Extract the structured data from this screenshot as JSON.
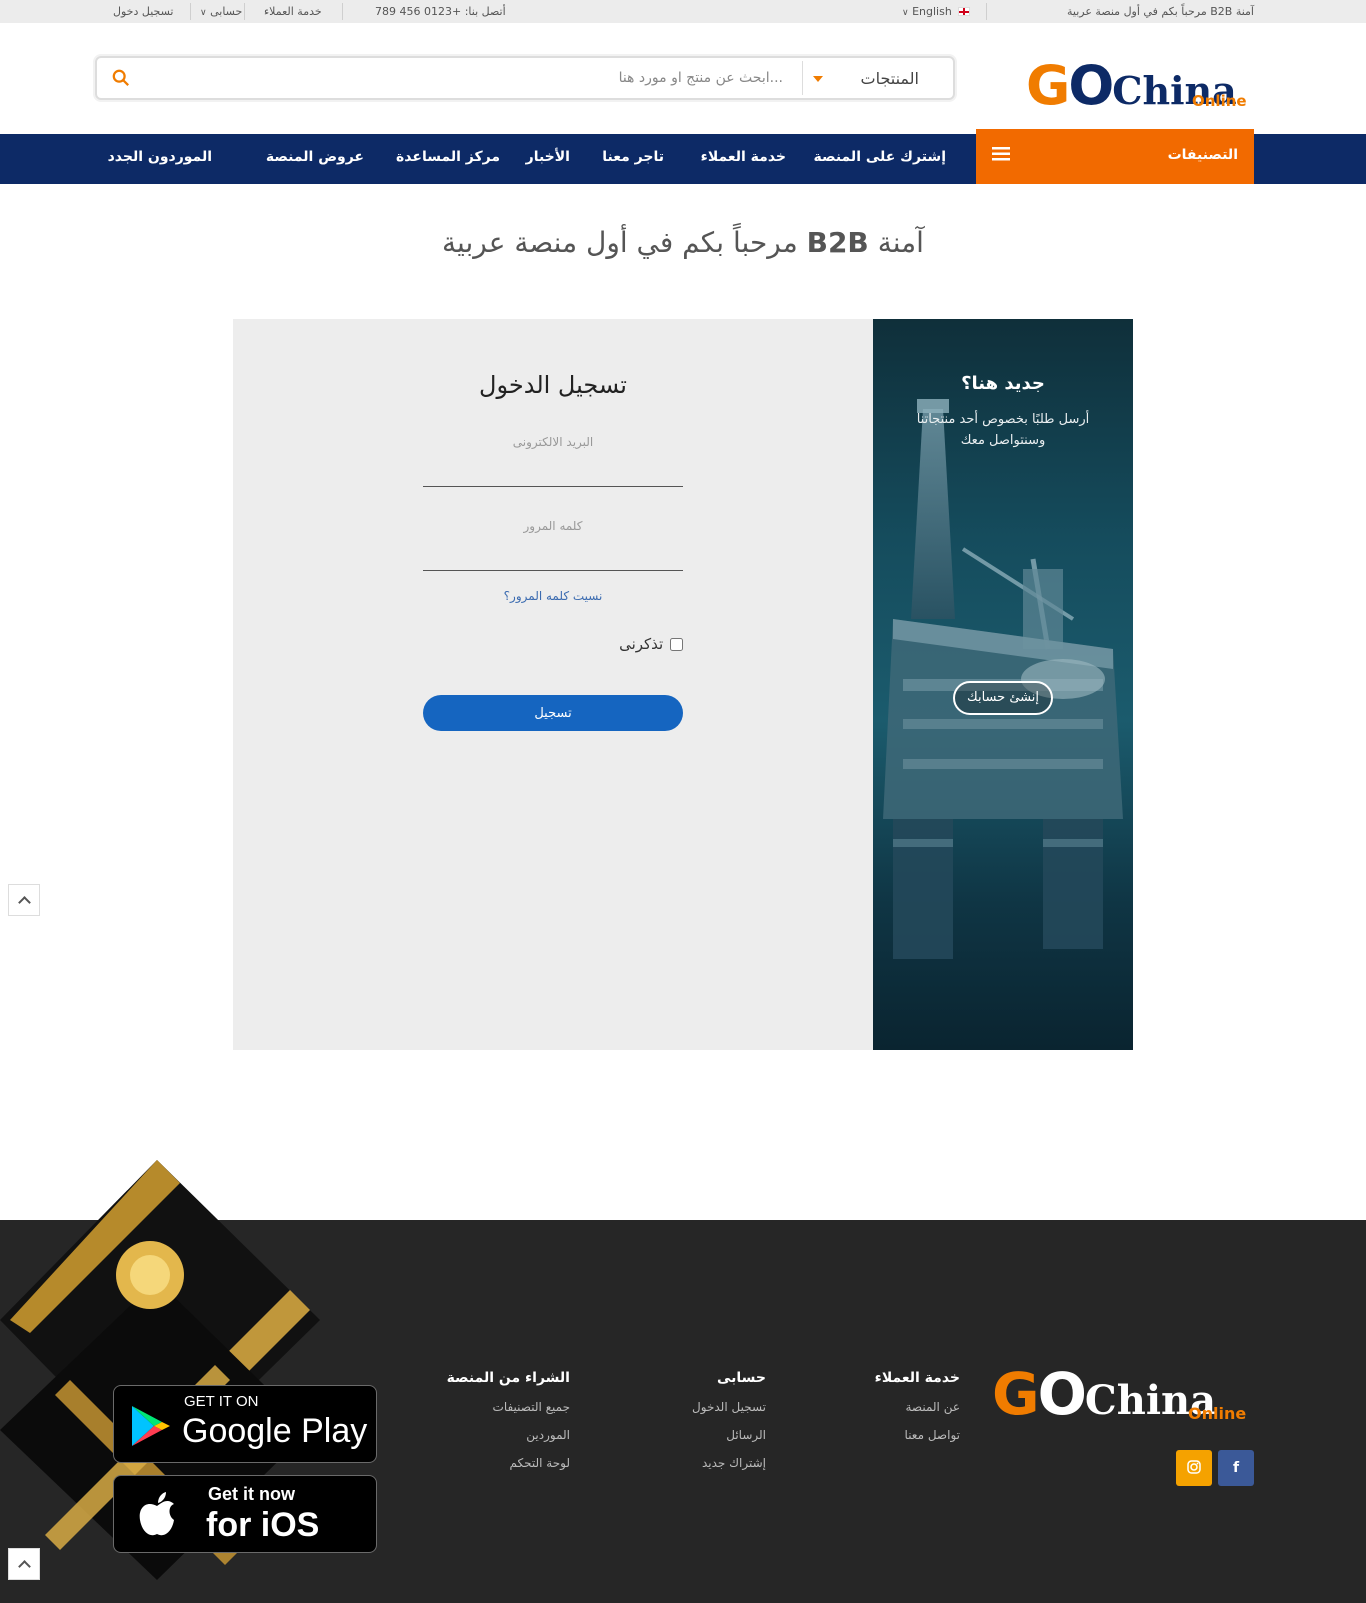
{
  "topbar": {
    "welcome": "مرحباً بكم في أول منصة عربية B2B آمنة",
    "language": "English",
    "contact": "أتصل بنا: +0123 456 789",
    "customer_service": "خدمة العملاء",
    "account": "حسابى",
    "login": "تسجيل دخول"
  },
  "header": {
    "logo_go": "GO",
    "logo_china": "China",
    "logo_online": "Online",
    "search_placeholder": "ابحث عن منتج او مورد هنا...",
    "search_category": "المنتجات"
  },
  "nav": {
    "categories": "التصنيفات",
    "items": [
      "إشترك على المنصة",
      "خدمة العملاء",
      "تاجر معنا",
      "الأخبار",
      "مركز المساعدة",
      "عروض المنصة",
      "الموردون الجدد"
    ]
  },
  "page": {
    "heading_pre": "مرحباً بكم في أول منصة عربية",
    "heading_bold": "B2B",
    "heading_post": "آمنة"
  },
  "login": {
    "title": "تسجيل الدخول",
    "email_label": "البريد الالكترونى",
    "password_label": "كلمه المرور",
    "forgot": "نسيت كلمه المرور؟",
    "remember": "تذكرنى",
    "submit": "تسجيل"
  },
  "promo": {
    "title": "جديد هنا؟",
    "text": "أرسل طلبًا بخصوص أحد منتجاتنا وسنتواصل معك",
    "button": "إنشئ حسابك"
  },
  "footer": {
    "col1": {
      "title": "خدمة العملاء",
      "links": [
        "عن المنصة",
        "تواصل معنا"
      ]
    },
    "col2": {
      "title": "حسابى",
      "links": [
        "تسجيل الدخول",
        "الرسائل",
        "إشتراك جديد"
      ]
    },
    "col3": {
      "title": "الشراء من المنصة",
      "links": [
        "جميع التصنيفات",
        "الموردين",
        "لوحة التحكم"
      ]
    },
    "google_small": "GET IT ON",
    "google_big": "Google Play",
    "ios_small": "Get it now",
    "ios_big": "for iOS"
  },
  "colors": {
    "navy": "#0d2a66",
    "orange": "#f26a00",
    "button_blue": "#1565c0",
    "footer": "#262626"
  },
  "icons": [
    "search-icon",
    "menu-icon",
    "facebook-icon",
    "instagram-icon",
    "chevron-up-icon",
    "play-store-icon",
    "apple-icon"
  ]
}
